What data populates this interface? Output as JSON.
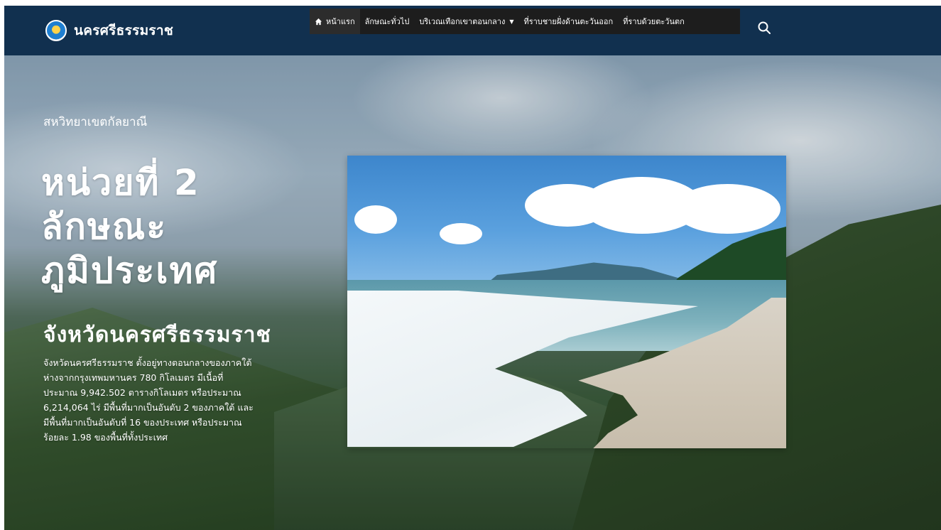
{
  "site": {
    "brand_name": "นครศรีธรรมราช"
  },
  "nav": {
    "items": [
      {
        "label": "หน้าแรก",
        "icon": "home-icon",
        "active": true
      },
      {
        "label": "ลักษณะทั่วไป"
      },
      {
        "label": "บริเวณเทือกเขาตอนกลาง",
        "has_dropdown": true
      },
      {
        "label": "ที่ราบชายฝั่งด้านตะวันออก"
      },
      {
        "label": "ที่ราบด้วยตะวันตก"
      }
    ],
    "search_icon": "search-icon"
  },
  "hero": {
    "subtitle": "สหวิทยาเขตกัลยาณี",
    "title_line1": "หน่วยที่ 2",
    "title_line2": "ลักษณะ",
    "title_line3": "ภูมิประเทศ",
    "province": "จังหวัดนครศรีธรรมราช",
    "description": "จังหวัดนครศรีธรรมราช ตั้งอยู่ทางตอนกลางของภาคใต้ ห่างจากกรุงเทพมหานคร 780 กิโลเมตร มีเนื้อที่ประมาณ 9,942.502 ตารางกิโลเมตร หรือประมาณ 6,214,064 ไร่ มีพื้นที่มากเป็นอันดับ 2 ของภาคใต้ และมีพื้นที่มากเป็นอันดับที่ 16 ของประเทศ หรือประมาณ ร้อยละ 1.98 ของพื้นที่ทั้งประเทศ"
  },
  "colors": {
    "navbar_bg": "#11304f",
    "menu_bg": "#1d1d1d",
    "text": "#ffffff"
  }
}
